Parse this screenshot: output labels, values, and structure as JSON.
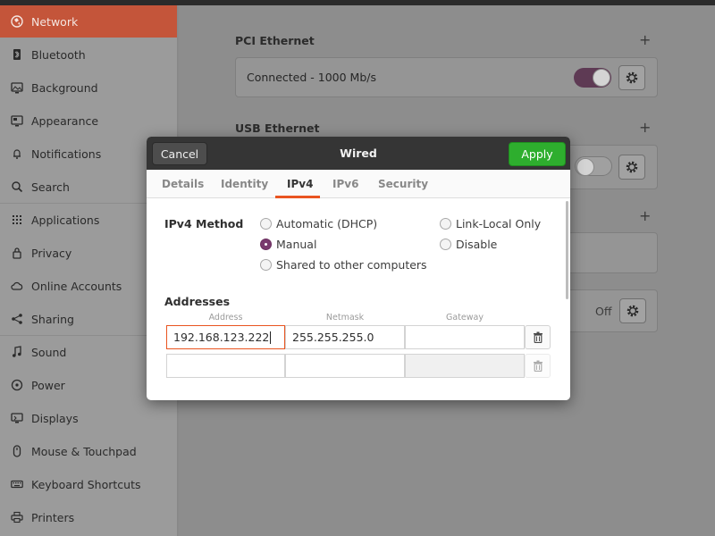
{
  "sidebar": {
    "items": [
      {
        "label": "Network",
        "icon": "network-icon",
        "active": true
      },
      {
        "label": "Bluetooth",
        "icon": "bluetooth-icon"
      },
      {
        "label": "Background",
        "icon": "background-icon"
      },
      {
        "label": "Appearance",
        "icon": "appearance-icon"
      },
      {
        "label": "Notifications",
        "icon": "bell-icon"
      },
      {
        "label": "Search",
        "icon": "search-icon"
      },
      {
        "label": "Applications",
        "icon": "grid-icon"
      },
      {
        "label": "Privacy",
        "icon": "lock-icon"
      },
      {
        "label": "Online Accounts",
        "icon": "cloud-icon"
      },
      {
        "label": "Sharing",
        "icon": "share-icon"
      },
      {
        "label": "Sound",
        "icon": "music-note-icon"
      },
      {
        "label": "Power",
        "icon": "power-icon"
      },
      {
        "label": "Displays",
        "icon": "display-icon"
      },
      {
        "label": "Mouse & Touchpad",
        "icon": "mouse-icon"
      },
      {
        "label": "Keyboard Shortcuts",
        "icon": "keyboard-icon"
      },
      {
        "label": "Printers",
        "icon": "printer-icon"
      }
    ]
  },
  "main": {
    "pci": {
      "title": "PCI Ethernet",
      "status": "Connected - 1000 Mb/s",
      "enabled": true
    },
    "usb": {
      "title": "USB Ethernet",
      "enabled": false
    },
    "off_label": "Off"
  },
  "dialog": {
    "title": "Wired",
    "cancel_label": "Cancel",
    "apply_label": "Apply",
    "tabs": [
      "Details",
      "Identity",
      "IPv4",
      "IPv6",
      "Security"
    ],
    "active_tab": "IPv4",
    "ipv4": {
      "method_label": "IPv4 Method",
      "options": {
        "automatic": "Automatic (DHCP)",
        "manual": "Manual",
        "shared": "Shared to other computers",
        "link_local": "Link-Local Only",
        "disable": "Disable"
      },
      "selected": "manual",
      "addresses_label": "Addresses",
      "columns": [
        "Address",
        "Netmask",
        "Gateway"
      ],
      "rows": [
        {
          "address": "192.168.123.222",
          "netmask": "255.255.255.0",
          "gateway": ""
        },
        {
          "address": "",
          "netmask": "",
          "gateway": ""
        }
      ]
    }
  },
  "colors": {
    "accent": "#e95420",
    "sidebar_active": "#c4553a",
    "apply_green": "#2eae2e",
    "toggle_on": "#5e3a54",
    "radio_checked": "#7a3a6e"
  }
}
